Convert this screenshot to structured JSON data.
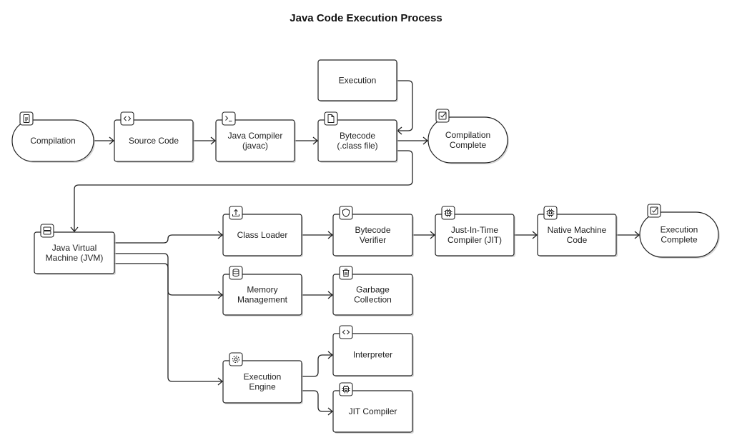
{
  "title": "Java Code Execution Process",
  "nodes": [
    {
      "id": "compilation",
      "label": [
        "Compilation"
      ],
      "shape": "stadium",
      "icon": "document-icon"
    },
    {
      "id": "source",
      "label": [
        "Source Code"
      ],
      "shape": "box",
      "icon": "code-icon"
    },
    {
      "id": "javac",
      "label": [
        "Java Compiler",
        "(javac)"
      ],
      "shape": "box",
      "icon": "terminal-icon"
    },
    {
      "id": "bytecode",
      "label": [
        "Bytecode",
        "(.class file)"
      ],
      "shape": "box",
      "icon": "file-icon"
    },
    {
      "id": "execution",
      "label": [
        "Execution"
      ],
      "shape": "box",
      "icon": null
    },
    {
      "id": "compcomplete",
      "label": [
        "Compilation",
        "Complete"
      ],
      "shape": "stadium",
      "icon": "check-square-icon"
    },
    {
      "id": "jvm",
      "label": [
        "Java Virtual",
        "Machine (JVM)"
      ],
      "shape": "box",
      "icon": "server-icon"
    },
    {
      "id": "classloader",
      "label": [
        "Class Loader"
      ],
      "shape": "box",
      "icon": "upload-icon"
    },
    {
      "id": "verifier",
      "label": [
        "Bytecode",
        "Verifier"
      ],
      "shape": "box",
      "icon": "shield-icon"
    },
    {
      "id": "jit",
      "label": [
        "Just-In-Time",
        "Compiler (JIT)"
      ],
      "shape": "box",
      "icon": "cpu-icon"
    },
    {
      "id": "native",
      "label": [
        "Native Machine",
        "Code"
      ],
      "shape": "box",
      "icon": "cpu-icon"
    },
    {
      "id": "execcomplete",
      "label": [
        "Execution",
        "Complete"
      ],
      "shape": "stadium",
      "icon": "check-square-icon"
    },
    {
      "id": "memory",
      "label": [
        "Memory",
        "Management"
      ],
      "shape": "box",
      "icon": "database-icon"
    },
    {
      "id": "gc",
      "label": [
        "Garbage",
        "Collection"
      ],
      "shape": "box",
      "icon": "trash-icon"
    },
    {
      "id": "interpreter",
      "label": [
        "Interpreter"
      ],
      "shape": "box",
      "icon": "code-icon"
    },
    {
      "id": "engine",
      "label": [
        "Execution",
        "Engine"
      ],
      "shape": "box",
      "icon": "gear-icon"
    },
    {
      "id": "jitcompiler",
      "label": [
        "JIT Compiler"
      ],
      "shape": "box",
      "icon": "cpu-icon"
    }
  ],
  "edges": [
    [
      "compilation",
      "source"
    ],
    [
      "source",
      "javac"
    ],
    [
      "javac",
      "bytecode"
    ],
    [
      "bytecode",
      "compcomplete"
    ],
    [
      "execution",
      "bytecode"
    ],
    [
      "bytecode",
      "jvm"
    ],
    [
      "jvm",
      "classloader"
    ],
    [
      "jvm",
      "memory"
    ],
    [
      "jvm",
      "engine"
    ],
    [
      "classloader",
      "verifier"
    ],
    [
      "verifier",
      "jit"
    ],
    [
      "jit",
      "native"
    ],
    [
      "native",
      "execcomplete"
    ],
    [
      "memory",
      "gc"
    ],
    [
      "engine",
      "interpreter"
    ],
    [
      "engine",
      "jitcompiler"
    ]
  ],
  "colors": {
    "stroke": "#222222",
    "fill": "#ffffff",
    "shadow": "#bbbbbb"
  }
}
